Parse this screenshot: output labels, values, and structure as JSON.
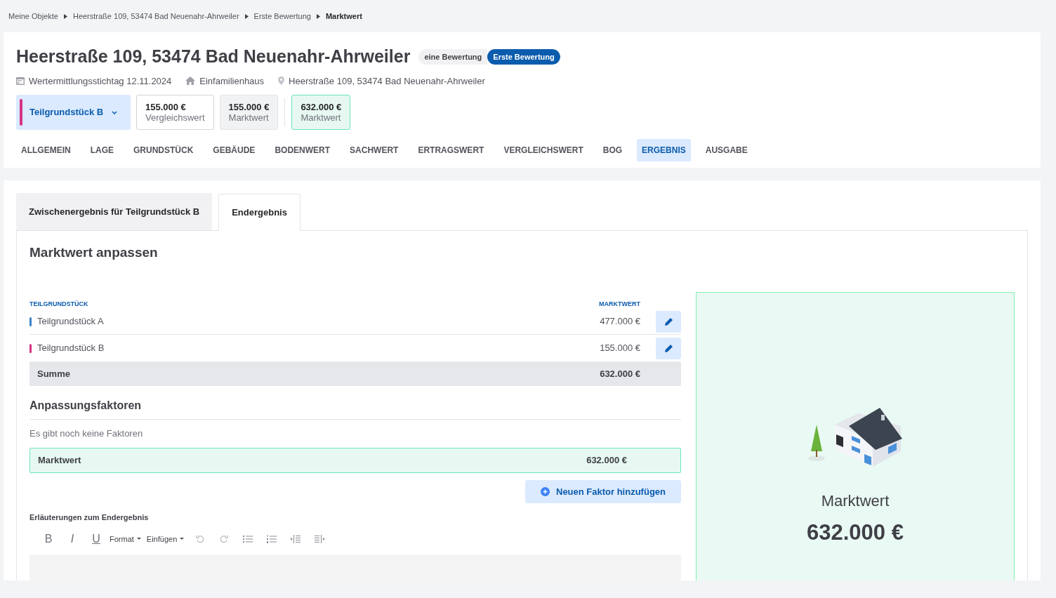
{
  "breadcrumb": [
    {
      "label": "Meine Objekte",
      "current": false
    },
    {
      "label": "Heerstraße 109, 53474 Bad Neuenahr-Ahrweiler",
      "current": false
    },
    {
      "label": "Erste Bewertung",
      "current": false
    },
    {
      "label": "Marktwert",
      "current": true
    }
  ],
  "title": "Heerstraße 109, 53474 Bad Neuenahr-Ahrweiler",
  "badges": [
    {
      "label": "eine Bewertung",
      "selected": false
    },
    {
      "label": "Erste Bewertung",
      "selected": true
    }
  ],
  "meta": [
    {
      "kind": "calendar",
      "text": "Wertermittlungsstichtag 12.11.2024"
    },
    {
      "kind": "home",
      "text": "Einfamilienhaus"
    },
    {
      "kind": "pin",
      "text": "Heerstraße 109, 53474 Bad Neuenahr-Ahrweiler"
    }
  ],
  "parcel_select": {
    "label": "Teilgrundstück B",
    "color": "#d63384"
  },
  "value_cards": [
    {
      "value": "155.000 €",
      "label": "Vergleichswert",
      "kind": "outline"
    },
    {
      "value": "155.000 €",
      "label": "Marktwert",
      "kind": "grey"
    },
    {
      "value": "632.000 €",
      "label": "Marktwert",
      "kind": "green"
    }
  ],
  "nav_tabs": [
    {
      "label": "ALLGEMEIN",
      "selected": false
    },
    {
      "label": "LAGE",
      "selected": false
    },
    {
      "label": "GRUNDSTÜCK",
      "selected": false
    },
    {
      "label": "GEBÄUDE",
      "selected": false
    },
    {
      "label": "BODENWERT",
      "selected": false
    },
    {
      "label": "SACHWERT",
      "selected": false
    },
    {
      "label": "ERTRAGSWERT",
      "selected": false
    },
    {
      "label": "VERGLEICHSWERT",
      "selected": false
    },
    {
      "label": "BOG",
      "selected": false
    },
    {
      "label": "ERGEBNIS",
      "selected": true
    },
    {
      "label": "AUSGABE",
      "selected": false
    }
  ],
  "result_tabs": [
    {
      "label": "Zwischenergebnis für Teilgrundstück B",
      "selected": false
    },
    {
      "label": "Endergebnis",
      "selected": true
    }
  ],
  "section_title": "Marktwert anpassen",
  "table": {
    "columns": [
      "TEILGRUNDSTÜCK",
      "MARKTWERT"
    ],
    "rows": [
      {
        "name": "Teilgrundstück A",
        "color": "#3b82c4",
        "value": "477.000 €"
      },
      {
        "name": "Teilgrundstück B",
        "color": "#d63384",
        "value": "155.000 €"
      }
    ],
    "sum": {
      "label": "Summe",
      "value": "632.000 €"
    }
  },
  "factors": {
    "heading": "Anpassungsfaktoren",
    "empty_text": "Es gibt noch keine Faktoren",
    "result_label": "Marktwert",
    "result_value": "632.000 €",
    "add_button": "Neuen Faktor hinzufügen"
  },
  "editor": {
    "label": "Erläuterungen zum Endergebnis",
    "toolbar": [
      {
        "kind": "bold",
        "label": "B"
      },
      {
        "kind": "italic",
        "label": "I"
      },
      {
        "kind": "underline",
        "label": "U"
      },
      {
        "kind": "menu",
        "label": "Format"
      },
      {
        "kind": "menu",
        "label": "Einfügen"
      },
      {
        "kind": "undo"
      },
      {
        "kind": "redo"
      },
      {
        "kind": "bullets"
      },
      {
        "kind": "numbers"
      },
      {
        "kind": "outdent"
      },
      {
        "kind": "indent"
      }
    ]
  },
  "summary": {
    "label": "Marktwert",
    "value": "632.000 €"
  }
}
